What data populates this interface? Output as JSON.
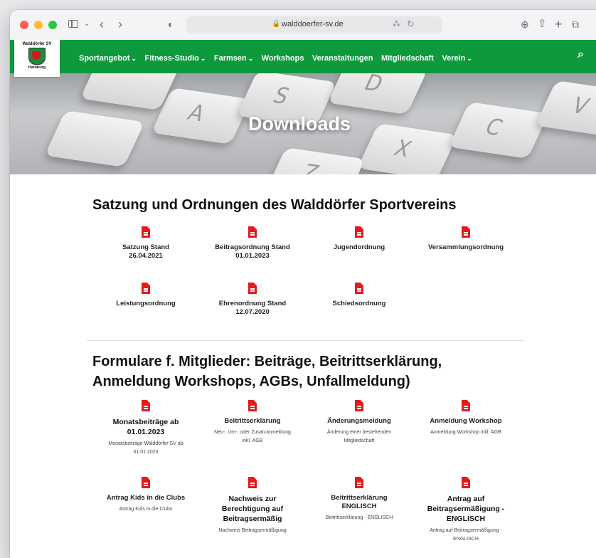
{
  "browser": {
    "url": "walddoerfer-sv.de",
    "icons": {
      "back": "‹",
      "forward": "›",
      "chevron": "⌄",
      "shield": "◐",
      "lock": "🔒",
      "translate": "⁂",
      "reload": "↻",
      "download": "⊕",
      "share": "⇧",
      "new_tab": "+",
      "tabs": "⧉"
    }
  },
  "site": {
    "logo_top": "Walddörfer SV",
    "logo_bottom": "Hamburg",
    "nav": [
      {
        "label": "Sportangebot",
        "caret": "⌄"
      },
      {
        "label": "Fitness-Studio",
        "caret": "⌄"
      },
      {
        "label": "Farmsen",
        "caret": "⌄"
      },
      {
        "label": "Workshops",
        "caret": ""
      },
      {
        "label": "Veranstaltungen",
        "caret": ""
      },
      {
        "label": "Mitgliedschaft",
        "caret": ""
      },
      {
        "label": "Verein",
        "caret": "⌄"
      }
    ],
    "search_icon": "⌕",
    "accent": "#0e9a3c",
    "pdf_color": "#e31b1b"
  },
  "hero": {
    "title": "Downloads",
    "keys": [
      "A",
      "S",
      "D",
      "X",
      "C",
      "V",
      "Z"
    ]
  },
  "sections": [
    {
      "title": "Satzung und Ordnungen des Walddörfer Sportvereins",
      "items": [
        {
          "title": "Satzung Stand 26.04.2021",
          "desc": ""
        },
        {
          "title": "Beitragsordnung Stand 01.01.2023",
          "desc": ""
        },
        {
          "title": "Jugendordnung",
          "desc": ""
        },
        {
          "title": "Versammlungsordnung",
          "desc": ""
        },
        {
          "title": "Leistungsordnung",
          "desc": ""
        },
        {
          "title": "Ehrenordnung Stand 12.07.2020",
          "desc": ""
        },
        {
          "title": "Schiedsordnung",
          "desc": ""
        }
      ]
    },
    {
      "title_line1": "Formulare f. Mitglieder: Beiträge, Beitrittserklärung,",
      "title_line2": "Anmeldung Workshops, AGBs, Unfallmeldung)",
      "items": [
        {
          "title": "Monatsbeiträge ab 01.01.2023",
          "desc": "Monatsbeiträge Walddörfer SV ab 01.01.2023"
        },
        {
          "title": "Beitrittserklärung",
          "desc": "Neu-, Um-, oder Zusatzanmeldung inkl. AGB"
        },
        {
          "title": "Änderungsmeldung",
          "desc": "Änderung einer bestehenden Mitgliedschaft"
        },
        {
          "title": "Anmeldung Workshop",
          "desc": "Anmeldung Workshop inkl. AGB"
        },
        {
          "title": "Antrag Kids in die Clubs",
          "desc": "Antrag Kids in die Clubs"
        },
        {
          "title": "Nachweis zur Berechtigung auf Beitragsermäßig",
          "desc": "Nachweis Beitragsermäßigung"
        },
        {
          "title": "Beitrittserklärung ENGLISCH",
          "desc": "Beitrittserklärung - ENGLISCH"
        },
        {
          "title": "Antrag auf Beitragsermäßigung - ENGLISCH",
          "desc": "Antrag auf Beitragsermäßigung - ENGLISCH"
        }
      ]
    }
  ]
}
